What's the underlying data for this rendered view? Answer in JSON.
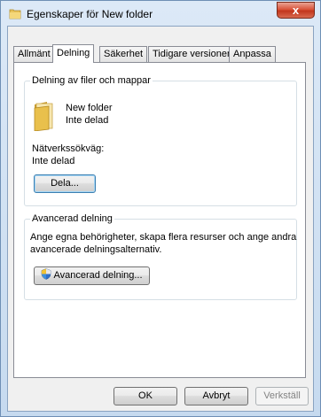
{
  "window": {
    "title": "Egenskaper för New folder",
    "close_glyph": "x"
  },
  "tabs": [
    {
      "label": "Allmänt",
      "active": false
    },
    {
      "label": "Delning",
      "active": true
    },
    {
      "label": "Säkerhet",
      "active": false
    },
    {
      "label": "Tidigare versioner",
      "active": false
    },
    {
      "label": "Anpassa",
      "active": false
    }
  ],
  "sharing": {
    "group_title": "Delning av filer och mappar",
    "folder_name": "New folder",
    "folder_status": "Inte delad",
    "network_path_label": "Nätverkssökväg:",
    "network_path_value": "Inte delad",
    "share_button": "Dela..."
  },
  "advanced": {
    "group_title": "Avancerad delning",
    "description_line1": "Ange egna behörigheter, skapa flera resurser och ange andra",
    "description_line2": "avancerade delningsalternativ.",
    "button": "Avancerad delning..."
  },
  "footer": {
    "ok": "OK",
    "cancel": "Avbryt",
    "apply": "Verkställ"
  },
  "icons": {
    "title": "folder-icon",
    "folder": "folder-icon",
    "shield": "uac-shield-icon"
  }
}
